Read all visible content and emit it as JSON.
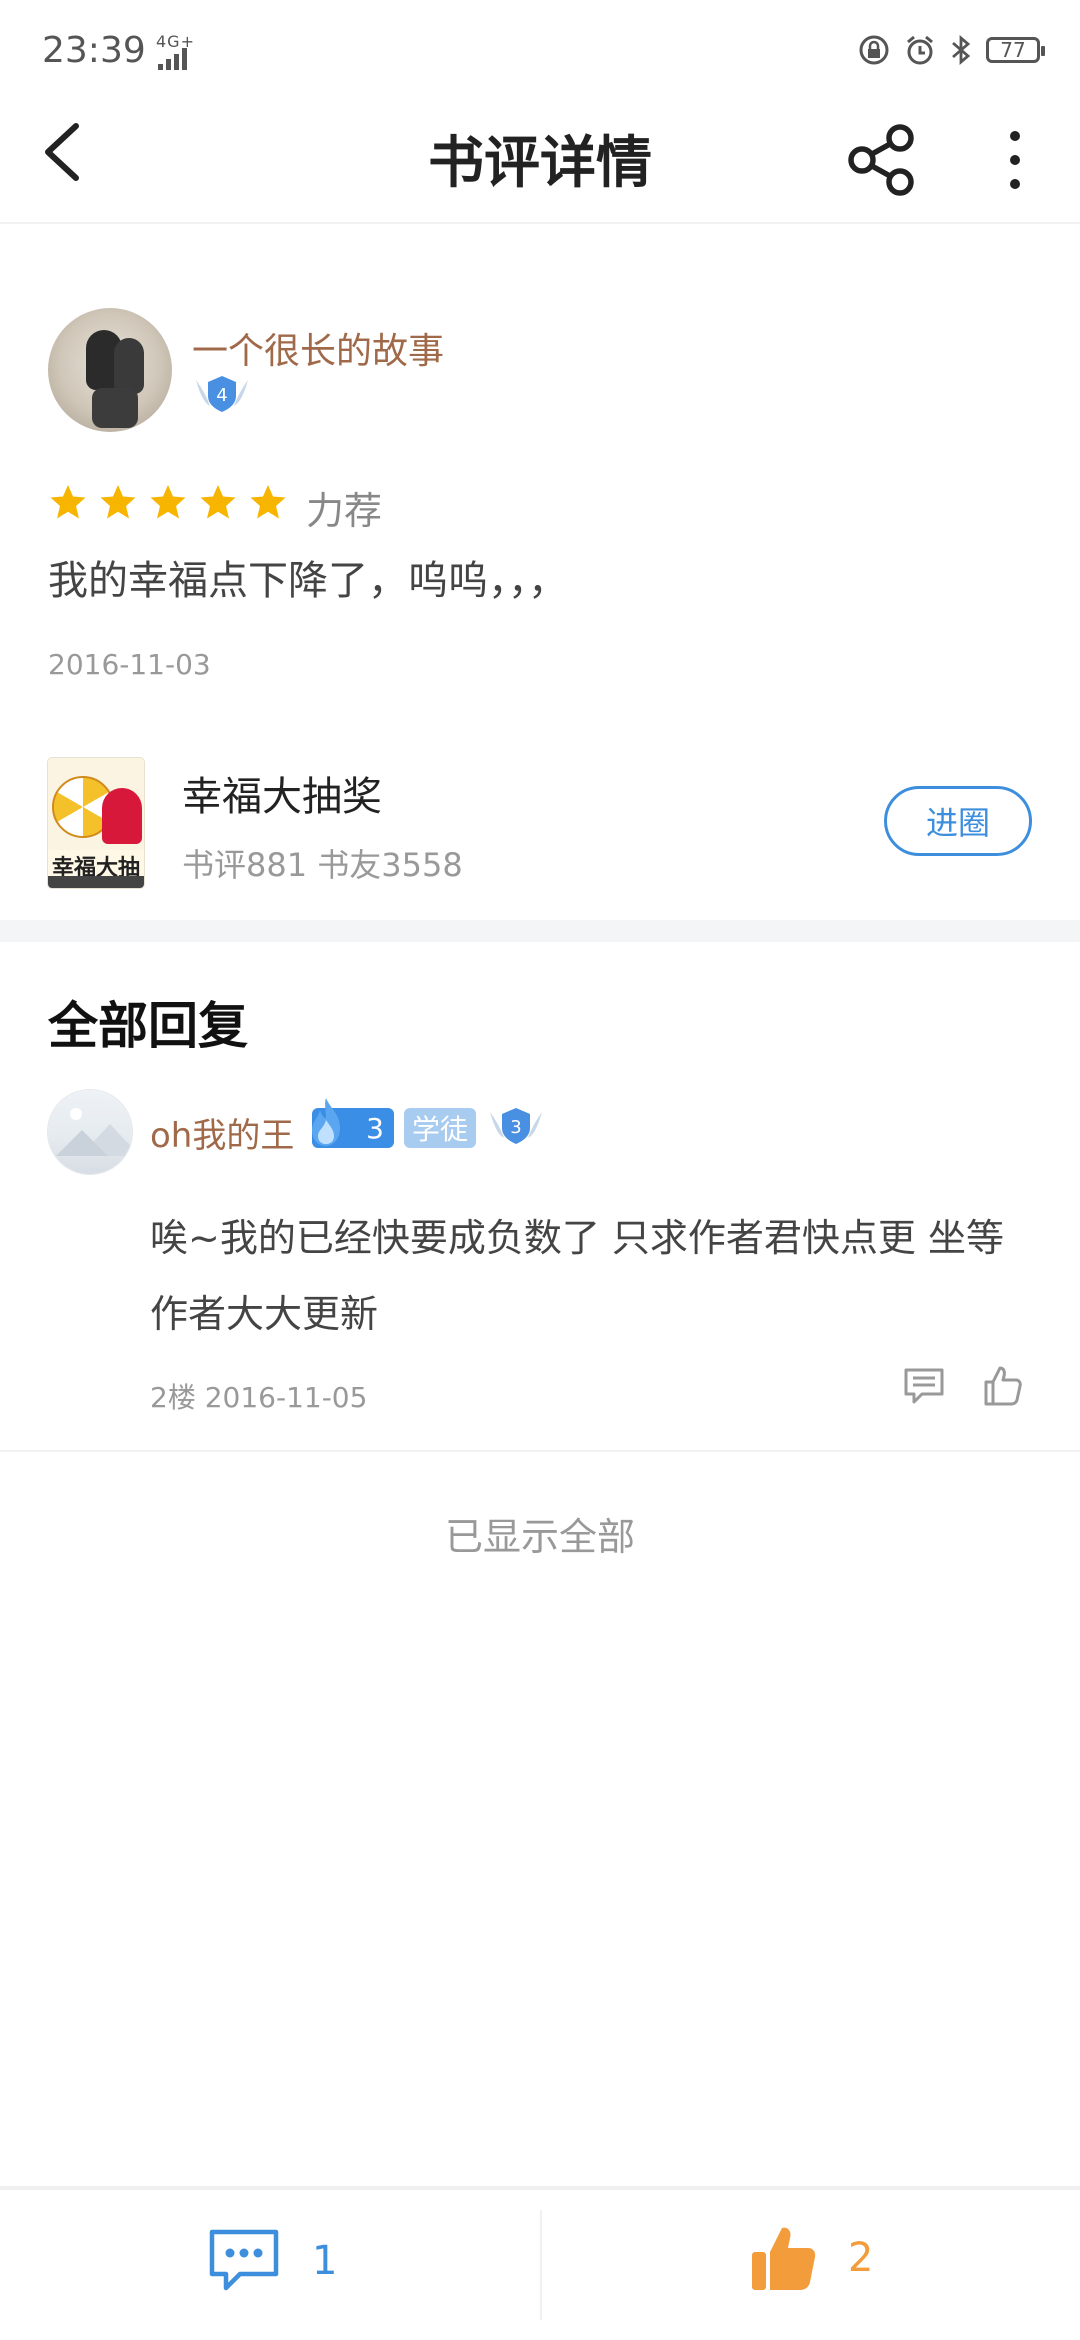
{
  "status_bar": {
    "time": "23:39",
    "network": "4G+",
    "battery": "77"
  },
  "header": {
    "title": "书评详情"
  },
  "review": {
    "author": "一个很长的故事",
    "author_level": "4",
    "rating": 5,
    "rating_label": "力荐",
    "text": "我的幸福点下降了，呜呜，，，",
    "date": "2016-11-03"
  },
  "book": {
    "cover_title": "幸福大抽奖",
    "title": "幸福大抽奖",
    "stats": "书评881 书友3558",
    "join_label": "进圈"
  },
  "replies": {
    "heading": "全部回复",
    "items": [
      {
        "author": "oh我的王",
        "fire_level": "3",
        "rank": "学徒",
        "level": "3",
        "text": "唉~我的已经快要成负数了 只求作者君快点更 坐等作者大大更新",
        "meta": "2楼 2016-11-05"
      }
    ],
    "end_note": "已显示全部"
  },
  "bottom_bar": {
    "comment_count": "1",
    "like_count": "2"
  },
  "colors": {
    "accent_blue": "#3d8edc",
    "name_brown": "#a06a4a",
    "star_yellow": "#f7b500",
    "like_orange": "#f39c3c"
  }
}
